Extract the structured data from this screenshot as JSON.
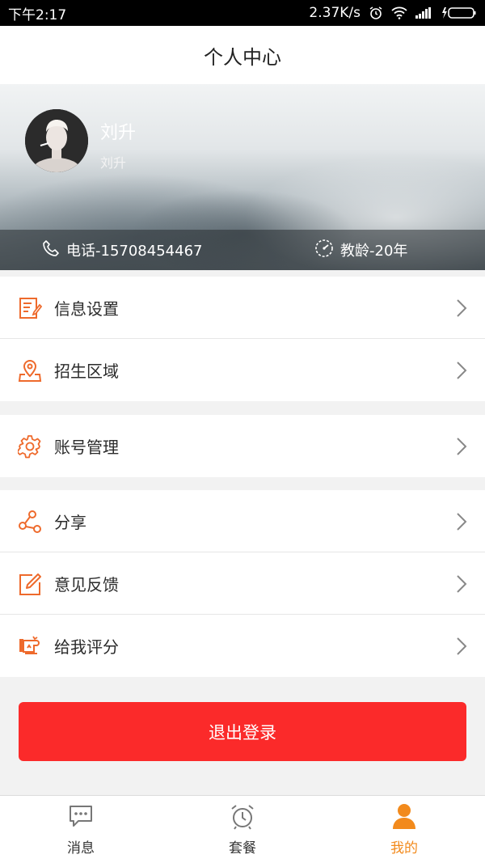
{
  "status_bar": {
    "time": "下午2:17",
    "speed": "2.37K/s"
  },
  "header": {
    "title": "个人中心"
  },
  "profile": {
    "name": "刘升",
    "nickname": "刘升",
    "phone": "电话-15708454467",
    "teaching_age": "教龄-20年"
  },
  "menu": {
    "group1": [
      {
        "label": "信息设置",
        "icon": "document-edit-icon"
      },
      {
        "label": "招生区域",
        "icon": "map-pin-icon"
      }
    ],
    "group2": [
      {
        "label": "账号管理",
        "icon": "gear-icon"
      }
    ],
    "group3": [
      {
        "label": "分享",
        "icon": "share-icon"
      },
      {
        "label": "意见反馈",
        "icon": "feedback-edit-icon"
      },
      {
        "label": "给我评分",
        "icon": "rating-icon"
      }
    ]
  },
  "logout_label": "退出登录",
  "tabbar": {
    "tabs": [
      {
        "label": "消息",
        "icon": "message-icon"
      },
      {
        "label": "套餐",
        "icon": "alarm-clock-icon"
      },
      {
        "label": "我的",
        "icon": "person-icon",
        "active": true
      }
    ]
  },
  "colors": {
    "accent": "#f28a1c",
    "icon_orange": "#ee6a2c",
    "logout_red": "#fb2a2a"
  }
}
